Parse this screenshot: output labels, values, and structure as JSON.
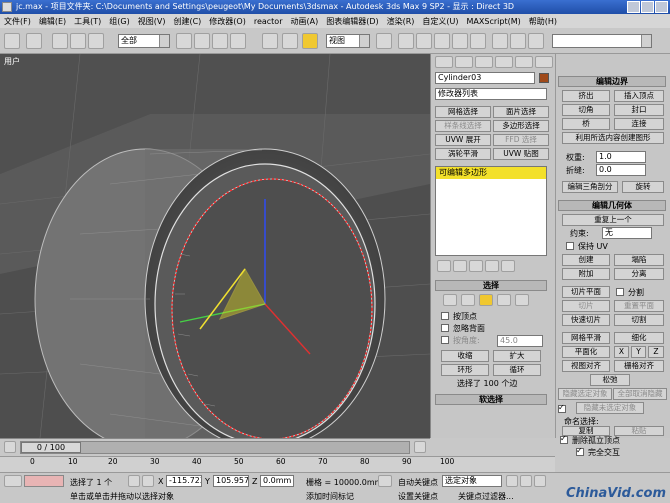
{
  "window": {
    "title": "jc.max - 项目文件夹: C:\\Documents and Settings\\peugeot\\My Documents\\3dsmax - Autodesk 3ds Max 9 SP2 - 显示 : Direct 3D"
  },
  "menu": [
    "文件(F)",
    "编辑(E)",
    "工具(T)",
    "组(G)",
    "视图(V)",
    "创建(C)",
    "修改器(O)",
    "reactor",
    "动画(A)",
    "图表编辑器(D)",
    "渲染(R)",
    "自定义(U)",
    "MAXScript(M)",
    "帮助(H)"
  ],
  "toolbar": {
    "selection_filter": "全部",
    "ref_coord": "视图"
  },
  "viewport": {
    "label": "用户"
  },
  "command_panel": {
    "object_name": "Cylinder03",
    "object_color": "#a04a1a",
    "modifier_list": "修改器列表",
    "quick_buttons": [
      [
        "网格选择",
        "面片选择"
      ],
      [
        "样条线选择",
        "多边形选择"
      ],
      [
        "UVW 展开",
        "FFD 选择"
      ],
      [
        "涡轮平滑",
        "UVW 贴图"
      ]
    ],
    "stack_item": "可编辑多边形"
  },
  "selection_rollout": {
    "title": "选择",
    "by_vertex": "按顶点",
    "ignore_backfaces": "忽略背面",
    "by_angle": "按角度:",
    "angle_value": "45.0",
    "shrink": "收缩",
    "grow": "扩大",
    "ring": "环形",
    "loop": "循环",
    "status": "选择了 100 个边",
    "soft_selection": "软选择"
  },
  "edit_edges": {
    "title": "编辑边界",
    "extrude": "挤出",
    "insert_vertex": "插入顶点",
    "chamfer": "切角",
    "cap": "封口",
    "bridge": "桥",
    "connect": "连接",
    "create_shape": "利用所选内容创建图形",
    "weight_label": "权重:",
    "weight_value": "1.0",
    "crease_label": "折缝:",
    "crease_value": "0.0",
    "edit_tri": "编辑三角剖分",
    "turn": "旋转"
  },
  "edit_geometry": {
    "title": "编辑几何体",
    "repeat_last": "重复上一个",
    "constraint_label": "约束:",
    "constraint_value": "无",
    "preserve_uv": "保持 UV",
    "create": "创建",
    "collapse": "塌陷",
    "attach": "附加",
    "detach": "分离",
    "slice_plane": "切片平面",
    "split": "分割",
    "slice": "切片",
    "reset_plane": "重置平面",
    "quickslice": "快速切片",
    "cut": "切割",
    "meshsmooth": "网格平滑",
    "tessellate": "细化",
    "make_planar": "平面化",
    "x": "X",
    "y": "Y",
    "z": "Z",
    "view_align": "视图对齐",
    "grid_align": "栅格对齐",
    "relax": "松弛",
    "hide_selected": "隐藏选定对象",
    "unhide_all": "全部取消隐藏",
    "hide_unselected": "隐藏未选定对象",
    "named_sel": "命名选择:",
    "copy": "复制",
    "paste": "粘贴",
    "delete_isolated": "删除孤立顶点",
    "full_interactivity": "完全交互"
  },
  "timeline": {
    "frame": "0 / 100",
    "ticks": [
      "0",
      "10",
      "20",
      "30",
      "40",
      "50",
      "60",
      "70",
      "80",
      "90",
      "100"
    ]
  },
  "status": {
    "selected": "选择了 1 个",
    "x_label": "X",
    "x_value": "-115.723m",
    "y_label": "Y",
    "y_value": "105.957mm",
    "z_label": "Z",
    "z_value": "0.0mm",
    "grid": "栅格 = 10000.0mm",
    "autokey": "自动关键点",
    "sel_mode": "选定对象",
    "setkey": "设置关键点",
    "key_filters": "关键点过滤器...",
    "prompt": "单击或单击并拖动以选择对象",
    "add_time_tag": "添加时间标记"
  },
  "watermark": "ChinaVid.com"
}
